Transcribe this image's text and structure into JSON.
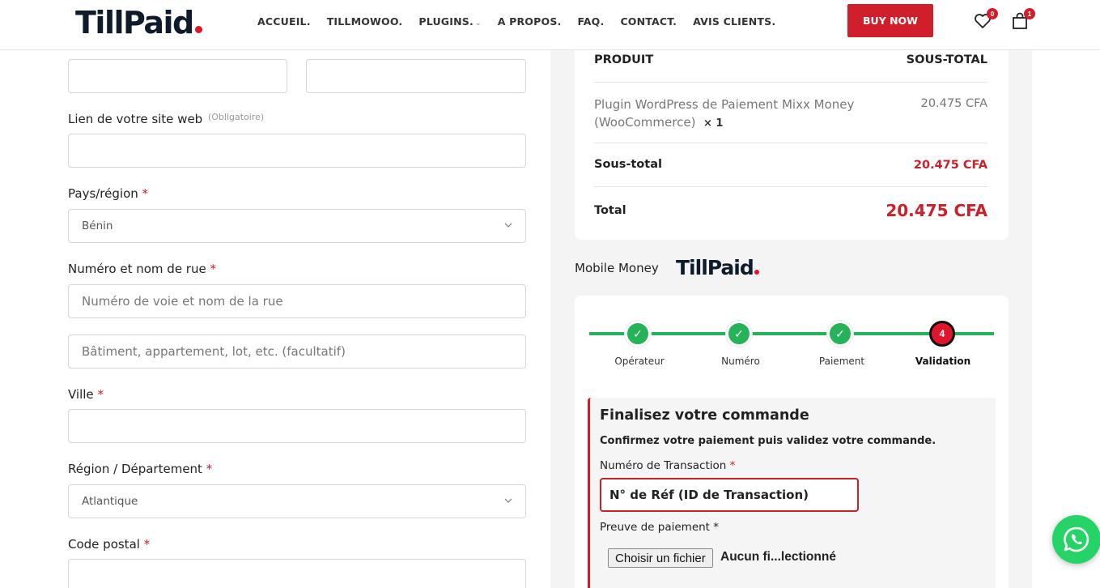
{
  "header": {
    "logo_text": "TillPaid",
    "nav": [
      "ACCUEIL.",
      "TILLMOWOO.",
      "PLUGINS.",
      "A PROPOS.",
      "FAQ.",
      "CONTACT.",
      "AVIS CLIENTS."
    ],
    "buy_label": "BUY NOW",
    "wishlist_count": "0",
    "cart_count": "1"
  },
  "form": {
    "website_label": "Lien de votre site web",
    "website_hint": "(Obligatoire)",
    "country_label": "Pays/région",
    "country_value": "Bénin",
    "street_label": "Numéro et nom de rue",
    "street_placeholder": "Numéro de voie et nom de la rue",
    "street2_placeholder": "Bâtiment, appartement, lot, etc. (facultatif)",
    "city_label": "Ville",
    "region_label": "Région / Département",
    "region_value": "Atlantique",
    "postal_label": "Code postal",
    "required_mark": "*"
  },
  "summary": {
    "col_product": "PRODUIT",
    "col_subtotal": "SOUS-TOTAL",
    "product_name": "Plugin WordPress de Paiement Mixx Money (WooCommerce)",
    "product_qty": "× 1",
    "product_price": "20.475 CFA",
    "subtotal_label": "Sous-total",
    "subtotal_value": "20.475 CFA",
    "total_label": "Total",
    "total_value": "20.475 CFA"
  },
  "payment": {
    "method_label": "Mobile Money",
    "logo_text": "TillPaid",
    "steps": [
      {
        "label": "Opérateur",
        "mark": "✓"
      },
      {
        "label": "Numéro",
        "mark": "✓"
      },
      {
        "label": "Paiement",
        "mark": "✓"
      },
      {
        "label": "Validation",
        "mark": "4"
      }
    ],
    "final_title": "Finalisez votre commande",
    "final_subtitle": "Confirmez votre paiement puis validez votre commande.",
    "tx_label": "Numéro de Transaction",
    "tx_placeholder": "N° de Réf (ID de Transaction)",
    "proof_label": "Preuve de paiement",
    "file_button": "Choisir un fichier",
    "file_status": "Aucun fi...lectionné",
    "required_mark": "*"
  },
  "colors": {
    "brand_red": "#d01f2a",
    "step_green": "#25b35a",
    "whatsapp": "#25d366"
  }
}
